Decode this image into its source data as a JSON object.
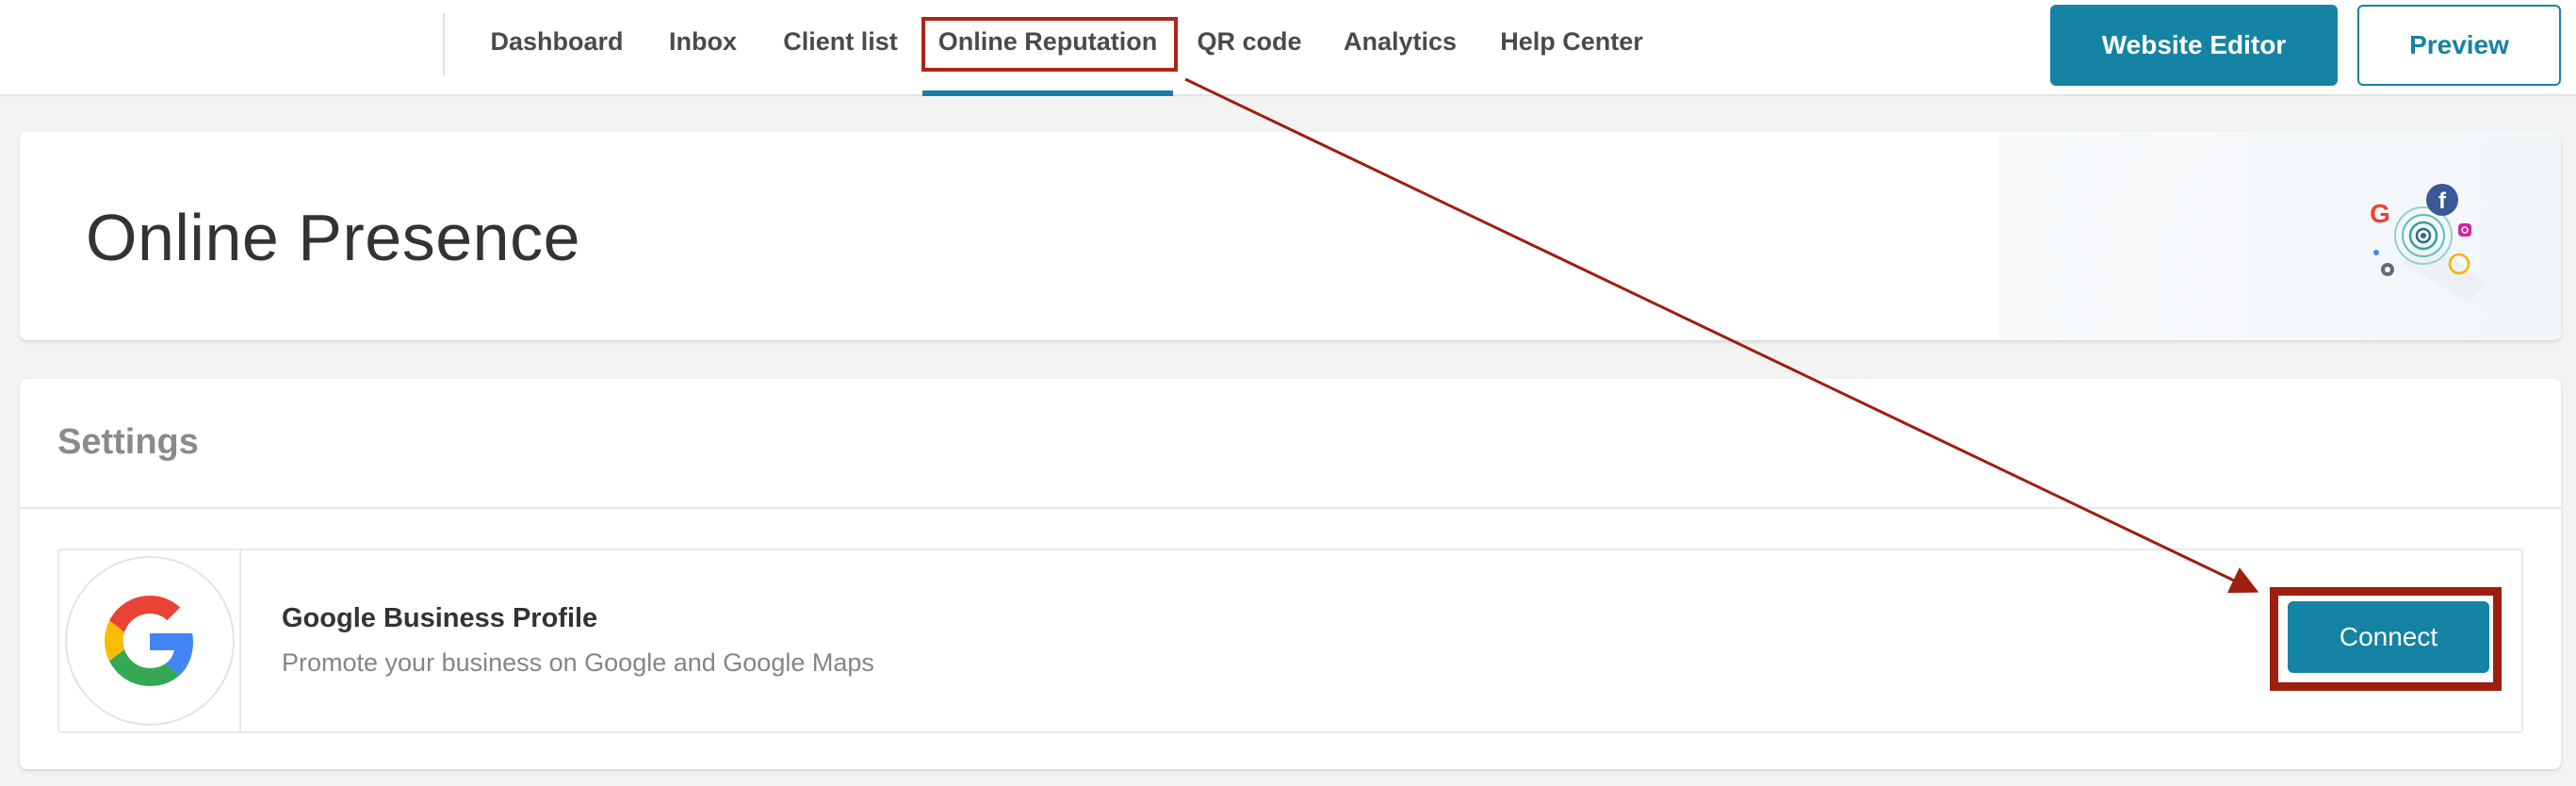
{
  "nav": {
    "tabs": [
      {
        "label": "Dashboard",
        "active": false
      },
      {
        "label": "Inbox",
        "active": false
      },
      {
        "label": "Client list",
        "active": false
      },
      {
        "label": "Online Reputation",
        "active": true
      },
      {
        "label": "QR code",
        "active": false
      },
      {
        "label": "Analytics",
        "active": false
      },
      {
        "label": "Help Center",
        "active": false
      }
    ],
    "website_editor_label": "Website Editor",
    "preview_label": "Preview"
  },
  "header": {
    "title": "Online Presence",
    "illustration_icon": "online-presence-illustration"
  },
  "settings": {
    "title": "Settings",
    "integrations": [
      {
        "name": "Google Business Profile",
        "description": "Promote your business on Google and Google Maps",
        "icon": "google-g-icon",
        "action_label": "Connect"
      }
    ]
  },
  "colors": {
    "accent": "#1583a3",
    "annotation": "#b02418",
    "background": "#f3f3f1"
  }
}
